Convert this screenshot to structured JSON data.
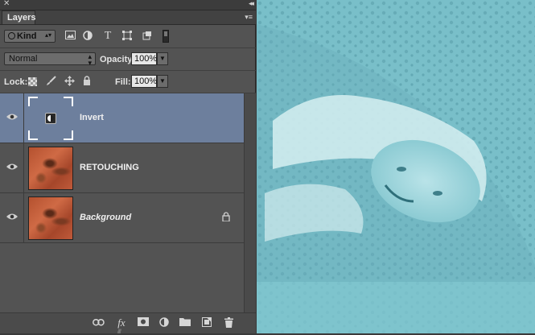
{
  "panel": {
    "close_glyph": "✕",
    "collapse_glyph": "◂◂",
    "tab_label": "Layers",
    "menu_glyph": "▾≡"
  },
  "filter": {
    "kind_label": "Kind",
    "icons": [
      "image-filter-icon",
      "adjustment-filter-icon",
      "type-filter-icon",
      "shape-filter-icon",
      "smart-object-filter-icon"
    ]
  },
  "blend": {
    "mode": "Normal",
    "opacity_label": "Opacity:",
    "opacity_value": "100%"
  },
  "lock": {
    "label": "Lock:",
    "fill_label": "Fill:",
    "fill_value": "100%"
  },
  "layers": [
    {
      "name": "Invert",
      "type": "adjustment",
      "selected": true,
      "visible": true
    },
    {
      "name": "RETOUCHING",
      "type": "pixel",
      "selected": false,
      "visible": true
    },
    {
      "name": "Background",
      "type": "pixel",
      "selected": false,
      "visible": true,
      "locked": true
    }
  ],
  "bottom_icons": [
    "link-layers-icon",
    "fx-icon",
    "add-mask-icon",
    "new-adjustment-icon",
    "new-group-icon",
    "new-layer-icon",
    "delete-layer-icon"
  ],
  "bottom": {
    "fx_label": "fx"
  },
  "colors": {
    "panel_bg": "#535353",
    "selected_layer": "#6d7f9d",
    "canvas_tint": "#7fc4cd"
  }
}
